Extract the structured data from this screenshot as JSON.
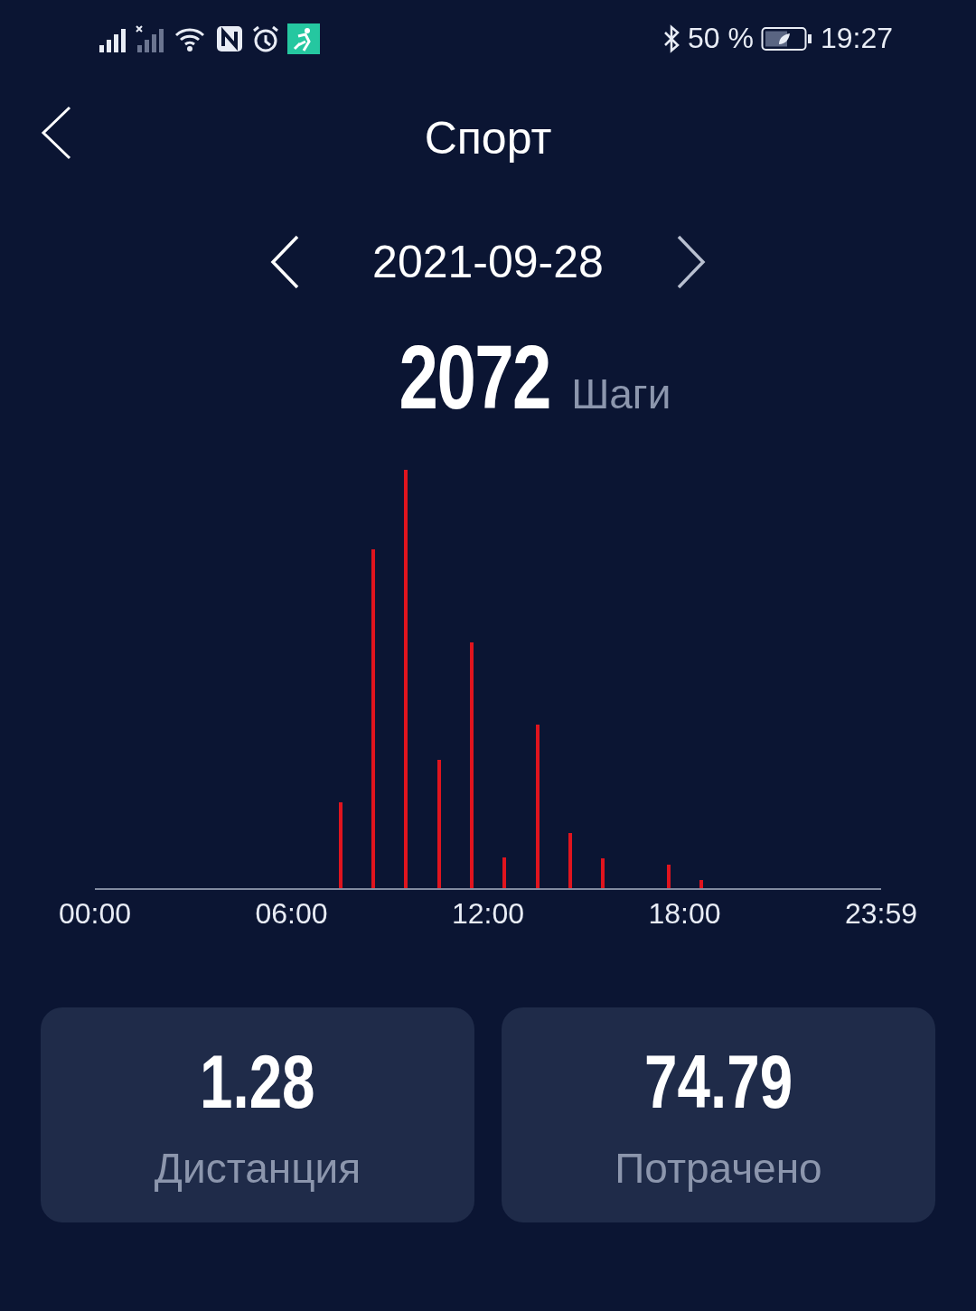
{
  "status_bar": {
    "battery_percent": "50 %",
    "time": "19:27"
  },
  "header": {
    "title": "Спорт"
  },
  "date_nav": {
    "date": "2021-09-28"
  },
  "steps": {
    "value": "2072",
    "unit": "Шаги"
  },
  "chart": {
    "x_labels": [
      "00:00",
      "06:00",
      "12:00",
      "18:00",
      "23:59"
    ]
  },
  "cards": [
    {
      "value": "1.28",
      "label": "Дистанция"
    },
    {
      "value": "74.79",
      "label": "Потрачено"
    }
  ]
}
